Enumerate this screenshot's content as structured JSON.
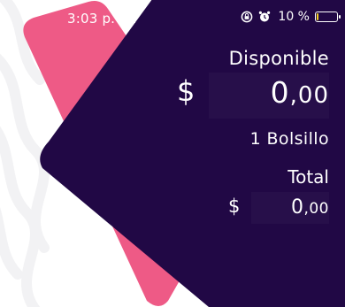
{
  "status_bar": {
    "time": "3:03 p. m.",
    "battery_percent_label": "10 %",
    "battery_level": 0.1,
    "battery_color": "#f6d020",
    "icons": [
      "rotation-lock-icon",
      "alarm-icon",
      "battery-icon"
    ]
  },
  "balance": {
    "available_label": "Disponible",
    "currency_symbol": "$",
    "available_integer": "0",
    "available_decimal": ",00",
    "pockets_label": "1 Bolsillo",
    "total_label": "Total",
    "total_currency_symbol": "$",
    "total_integer": "0",
    "total_decimal": ",00"
  },
  "colors": {
    "card_dark": "#210845",
    "card_accent": "#ee5a86",
    "background": "#ffffff",
    "text": "#ffffff"
  }
}
